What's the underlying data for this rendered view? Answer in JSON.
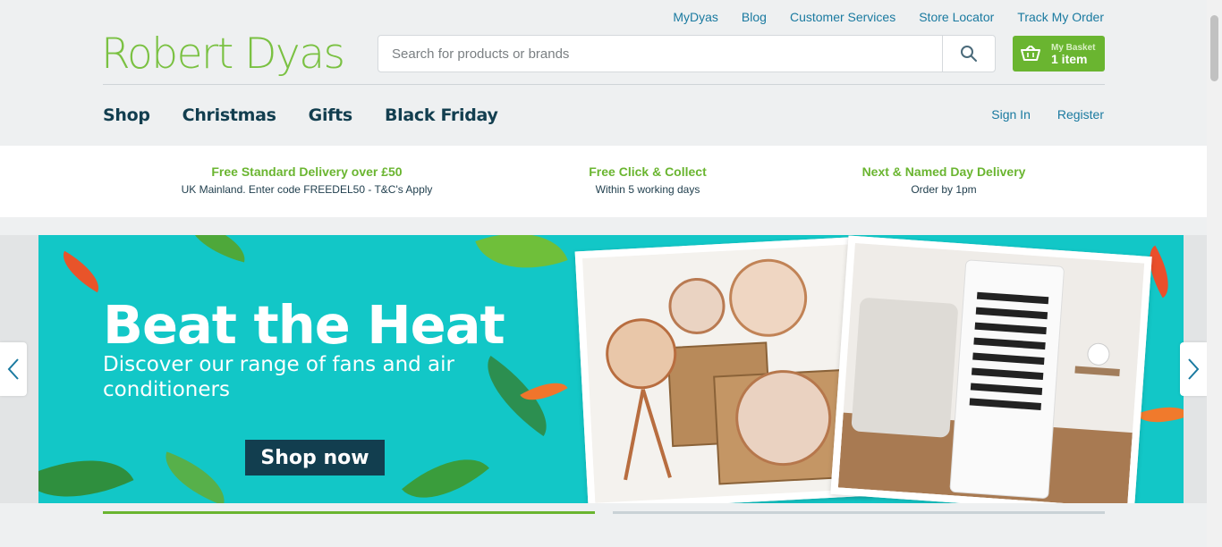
{
  "header": {
    "util_links": [
      "MyDyas",
      "Blog",
      "Customer Services",
      "Store Locator",
      "Track My Order"
    ],
    "logo": "Robert Dyas",
    "search_placeholder": "Search for products or brands",
    "basket": {
      "label": "My Basket",
      "count": "1 item"
    },
    "nav": [
      "Shop",
      "Christmas",
      "Gifts",
      "Black Friday"
    ],
    "account": {
      "sign_in": "Sign In",
      "register": "Register"
    }
  },
  "usp": [
    {
      "title": "Free Standard Delivery over £50",
      "sub": "UK Mainland. Enter code FREEDEL50 - T&C's Apply"
    },
    {
      "title": "Free Click & Collect",
      "sub": "Within 5 working days"
    },
    {
      "title": "Next & Named Day Delivery",
      "sub": "Order by 1pm"
    }
  ],
  "hero": {
    "title": "Beat the Heat",
    "subtitle": "Discover our range of fans and air conditioners",
    "cta": "Shop now",
    "brand_color": "#12c7c7"
  },
  "colors": {
    "green": "#6ab530",
    "navy": "#123e4f",
    "link": "#1a7aa0"
  }
}
